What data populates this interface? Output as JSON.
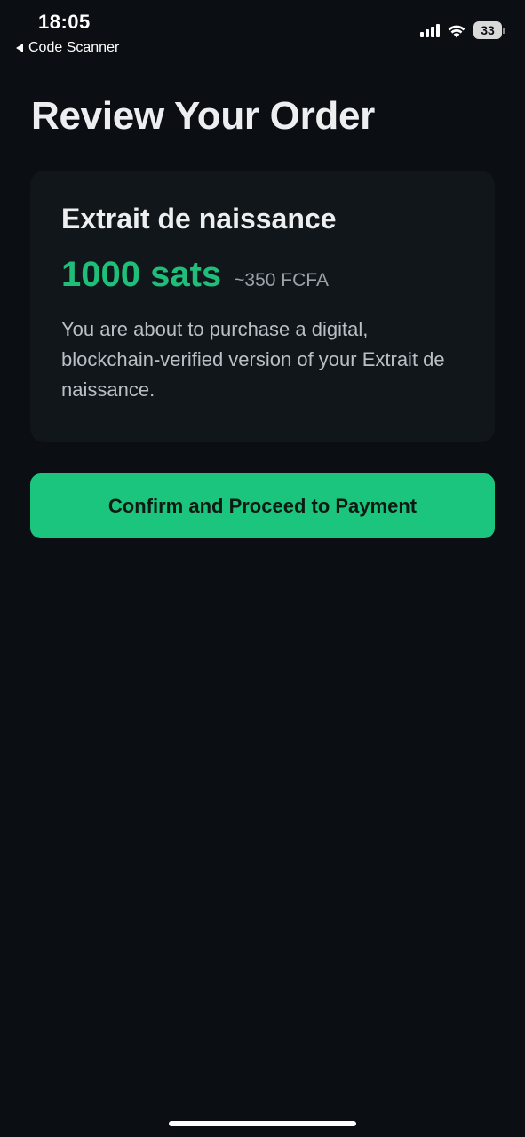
{
  "status_bar": {
    "time": "18:05",
    "battery_level": "33",
    "battery_percent": 33,
    "signal_icon": "cellular-signal-icon",
    "wifi_icon": "wifi-icon",
    "battery_icon": "battery-icon"
  },
  "navigation": {
    "back_label": "Code Scanner",
    "back_icon": "back-arrow-icon"
  },
  "page": {
    "title": "Review Your Order"
  },
  "order": {
    "product_name": "Extrait de naissance",
    "price_sats": "1000 sats",
    "price_fiat": "~350 FCFA",
    "description": "You are about to purchase a digital, blockchain-verified version of your Extrait de naissance."
  },
  "actions": {
    "confirm_label": "Confirm and Proceed to Payment"
  },
  "colors": {
    "background": "#0b0f13",
    "card": "#11161b",
    "accent": "#1cc57d",
    "price_text": "#1fbf7a",
    "muted_text": "#9aa1a8"
  }
}
